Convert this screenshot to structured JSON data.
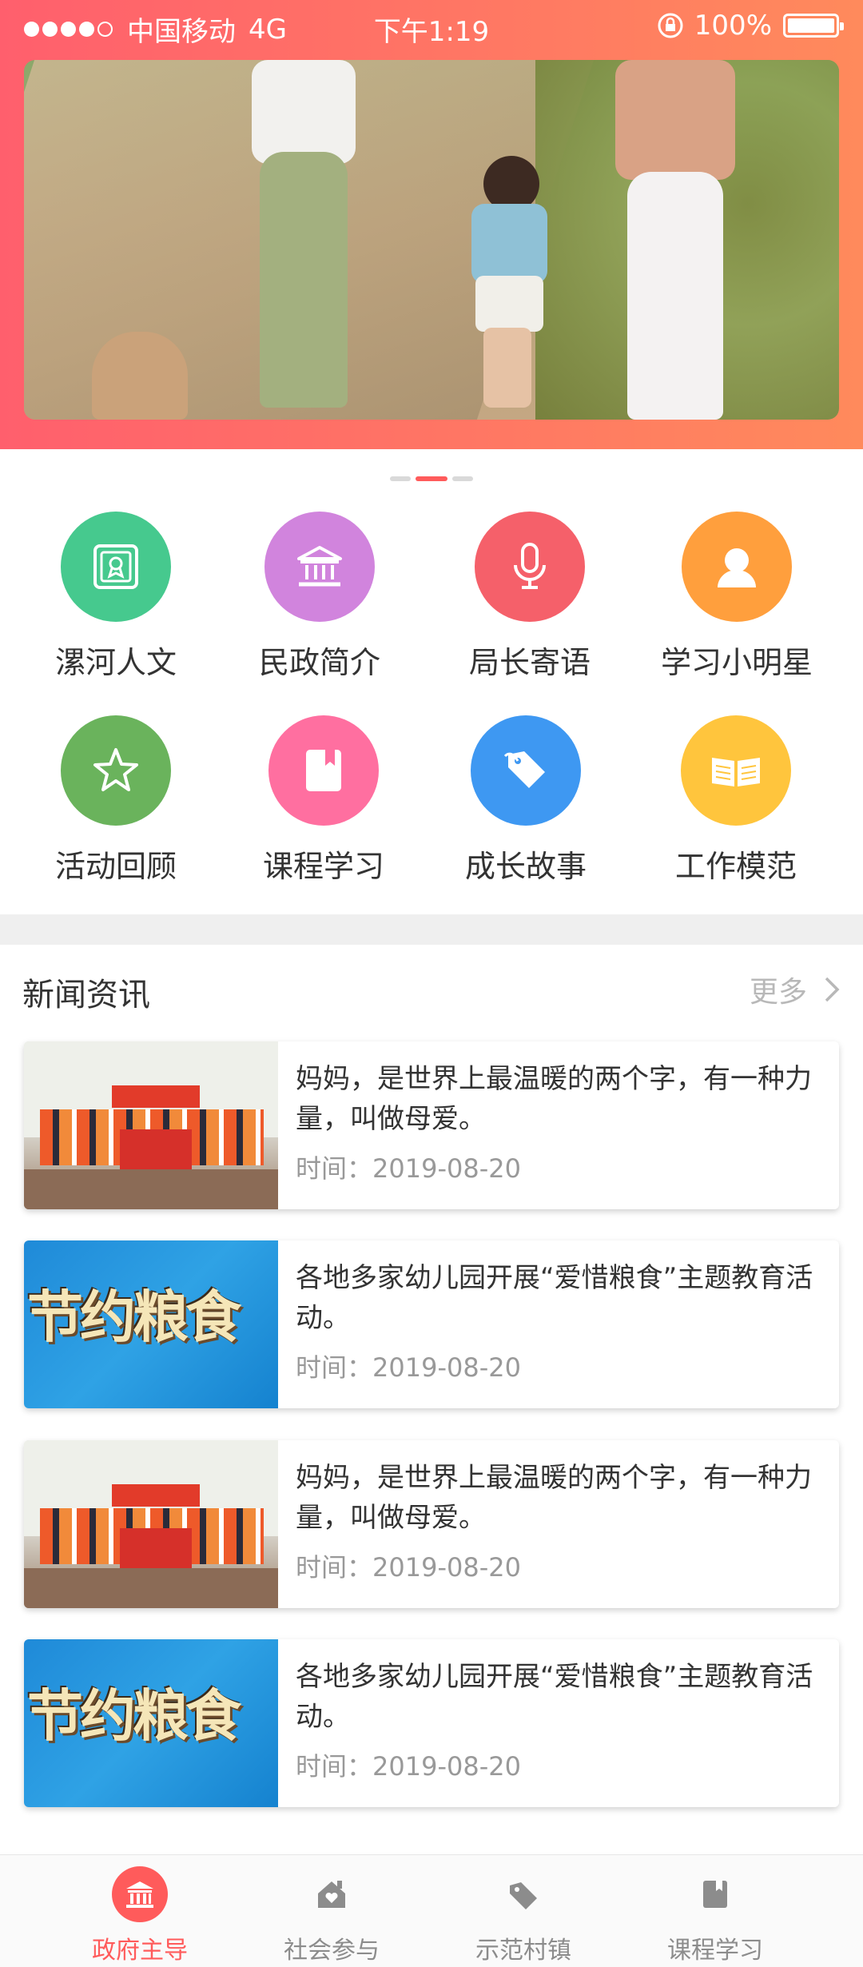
{
  "status_bar": {
    "carrier": "中国移动",
    "network": "4G",
    "time": "下午1:19",
    "battery": "100%"
  },
  "banner": {
    "pages": 3,
    "active_page": 2
  },
  "grid": [
    {
      "label": "漯河人文",
      "icon": "certificate-icon",
      "color": "#46c98e"
    },
    {
      "label": "民政简介",
      "icon": "building-icon",
      "color": "#d184dd"
    },
    {
      "label": "局长寄语",
      "icon": "microphone-icon",
      "color": "#f5606a"
    },
    {
      "label": "学习小明星",
      "icon": "person-icon",
      "color": "#ff9f3d"
    },
    {
      "label": "活动回顾",
      "icon": "star-icon",
      "color": "#6ab35c"
    },
    {
      "label": "课程学习",
      "icon": "book-icon",
      "color": "#ff6fa0"
    },
    {
      "label": "成长故事",
      "icon": "tag-icon",
      "color": "#3e98f2"
    },
    {
      "label": "工作模范",
      "icon": "open-book-icon",
      "color": "#ffc53d"
    }
  ],
  "news": {
    "title": "新闻资讯",
    "more": "更多",
    "items": [
      {
        "title": "妈妈，是世界上最温暖的两个字，有一种力量，叫做母爱。",
        "time": "时间：2019-08-20",
        "image": "group-photo"
      },
      {
        "title": "各地多家幼儿园开展“爱惜粮食”主题教育活动。",
        "time": "时间：2019-08-20",
        "image": "food-text",
        "image_text": "节约粮食"
      },
      {
        "title": "妈妈，是世界上最温暖的两个字，有一种力量，叫做母爱。",
        "time": "时间：2019-08-20",
        "image": "group-photo"
      },
      {
        "title": "各地多家幼儿园开展“爱惜粮食”主题教育活动。",
        "time": "时间：2019-08-20",
        "image": "food-text",
        "image_text": "节约粮食"
      }
    ]
  },
  "tabs": [
    {
      "label": "政府主导",
      "icon": "government-icon",
      "active": true
    },
    {
      "label": "社会参与",
      "icon": "home-heart-icon",
      "active": false
    },
    {
      "label": "示范村镇",
      "icon": "tag-icon",
      "active": false
    },
    {
      "label": "课程学习",
      "icon": "book-icon",
      "active": false
    }
  ],
  "colors": {
    "accent": "#ff5b5b",
    "header_start": "#ff5f6d",
    "header_end": "#ff8a5c"
  }
}
